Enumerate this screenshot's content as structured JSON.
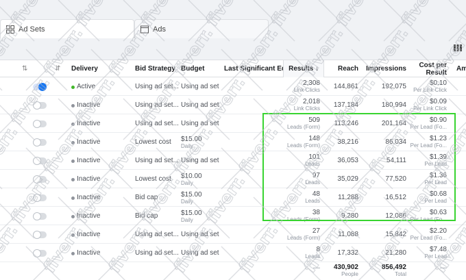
{
  "tabs": [
    {
      "label": "Ad Sets",
      "icon": "grid-icon"
    },
    {
      "label": "Ads",
      "icon": "ad-card-icon"
    }
  ],
  "columns": {
    "delivery": "Delivery",
    "bid_strategy": "Bid Strategy",
    "budget": "Budget",
    "last_edit": "Last Significant Edit",
    "results": "Results",
    "reach": "Reach",
    "impressions": "Impressions",
    "cost_per_result_1": "Cost per",
    "cost_per_result_2": "Result",
    "amount_spent": "Am"
  },
  "rows": [
    {
      "status": "Active",
      "active": true,
      "bid": "Using ad set...",
      "budget": "Using ad set",
      "budget_sub": "",
      "results": "2,308",
      "results_sub": "Link Clicks",
      "reach": "144,861",
      "impressions": "192,075",
      "cost": "$0.10",
      "cost_sub": "Per Link Click"
    },
    {
      "status": "Inactive",
      "active": false,
      "bid": "Using ad set...",
      "budget": "Using ad set",
      "budget_sub": "",
      "results": "2,018",
      "results_sub": "Link Clicks",
      "reach": "137,184",
      "impressions": "180,994",
      "cost": "$0.09",
      "cost_sub": "Per Link Click"
    },
    {
      "status": "Inactive",
      "active": false,
      "bid": "Using ad set...",
      "budget": "Using ad set",
      "budget_sub": "",
      "results": "509",
      "results_sub": "Leads (Form)",
      "reach": "113,246",
      "impressions": "201,164",
      "cost": "$0.90",
      "cost_sub": "Per Lead (Fo..."
    },
    {
      "status": "Inactive",
      "active": false,
      "bid": "Lowest cost",
      "budget": "$15.00",
      "budget_sub": "Daily",
      "results": "148",
      "results_sub": "Leads (Form)",
      "reach": "38,216",
      "impressions": "86,034",
      "cost": "$1.23",
      "cost_sub": "Per Lead (Fo..."
    },
    {
      "status": "Inactive",
      "active": false,
      "bid": "Using ad set...",
      "budget": "Using ad set",
      "budget_sub": "",
      "results": "101",
      "results_sub": "Leads",
      "reach": "36,053",
      "impressions": "54,111",
      "cost": "$1.39",
      "cost_sub": "Per Lead"
    },
    {
      "status": "Inactive",
      "active": false,
      "bid": "Lowest cost",
      "budget": "$10.00",
      "budget_sub": "Daily",
      "results": "97",
      "results_sub": "Leads",
      "reach": "35,029",
      "impressions": "77,520",
      "cost": "$1.36",
      "cost_sub": "Per Lead"
    },
    {
      "status": "Inactive",
      "active": false,
      "bid": "Bid cap",
      "budget": "$15.00",
      "budget_sub": "Daily",
      "results": "48",
      "results_sub": "Leads",
      "reach": "11,288",
      "impressions": "16,512",
      "cost": "$0.68",
      "cost_sub": "Per Lead"
    },
    {
      "status": "Inactive",
      "active": false,
      "bid": "Bid cap",
      "budget": "$15.00",
      "budget_sub": "Daily",
      "results": "38",
      "results_sub": "Leads (Form)",
      "reach": "9,280",
      "impressions": "12,086",
      "cost": "$0.63",
      "cost_sub": "Per Lead (Fo..."
    },
    {
      "status": "Inactive",
      "active": false,
      "bid": "Using ad set...",
      "budget": "Using ad set",
      "budget_sub": "",
      "results": "27",
      "results_sub": "Leads (Form)",
      "reach": "11,088",
      "impressions": "15,842",
      "cost": "$2.20",
      "cost_sub": "Per Lead (Fo..."
    },
    {
      "status": "Inactive",
      "active": false,
      "bid": "Using ad set...",
      "budget": "Using ad set",
      "budget_sub": "",
      "results": "8",
      "results_sub": "Leads",
      "reach": "17,332",
      "impressions": "21,280",
      "cost": "$7.48",
      "cost_sub": "Per Lead"
    }
  ],
  "totals": {
    "results": "—",
    "reach": "430,902",
    "reach_sub": "People",
    "impressions": "856,492",
    "impressions_sub": "Total",
    "cost": "—"
  },
  "watermark": "fiverr.",
  "colors": {
    "highlight": "#38d430",
    "active": "#42b72a",
    "toggle_on": "#1877f2"
  }
}
